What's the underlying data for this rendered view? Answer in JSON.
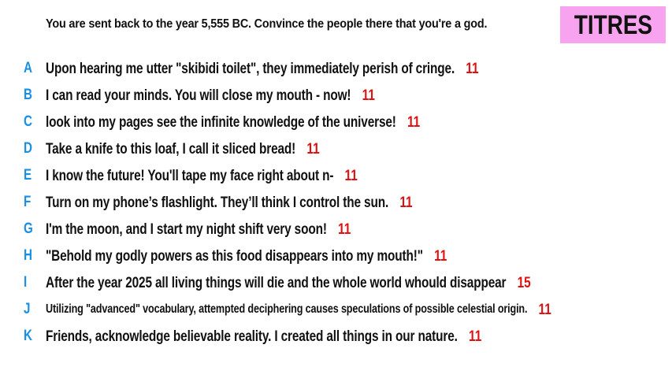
{
  "prompt": "You are sent back to the year 5,555 BC. Convince the people there that you're a god.",
  "logo": {
    "text": "TITRES",
    "background": "#f7a3f0"
  },
  "colors": {
    "letter": "#1a8fe3",
    "score": "#e01010",
    "text": "#111111"
  },
  "answers": [
    {
      "letter": "A",
      "text": "Upon hearing me utter \"skibidi toilet\", they immediately perish of cringe.",
      "score": "11"
    },
    {
      "letter": "B",
      "text": "I can read your minds. You will close my mouth - now!",
      "score": "11"
    },
    {
      "letter": "C",
      "text": "look into my pages see the infinite knowledge of the universe!",
      "score": "11"
    },
    {
      "letter": "D",
      "text": "Take a knife to this loaf, I call it sliced bread!",
      "score": "11"
    },
    {
      "letter": "E",
      "text": "I know the future! You'll tape my face right about n-",
      "score": "11"
    },
    {
      "letter": "F",
      "text": "Turn on my phone’s flashlight. They’ll think I control the sun.",
      "score": "11"
    },
    {
      "letter": "G",
      "text": "I'm the moon, and I start my night shift very soon!",
      "score": "11"
    },
    {
      "letter": "H",
      "text": "\"Behold my godly powers as this food disappears into my mouth!\"",
      "score": "11"
    },
    {
      "letter": "I",
      "text": "After the year 2025 all living things will die and the whole world whould disappear",
      "score": "15"
    },
    {
      "letter": "J",
      "text": "Utilizing \"advanced\" vocabulary, attempted deciphering causes speculations of possible celestial origin.",
      "score": "11"
    },
    {
      "letter": "K",
      "text": "Friends, acknowledge believable reality. I created all things in our nature.",
      "score": "11"
    }
  ]
}
